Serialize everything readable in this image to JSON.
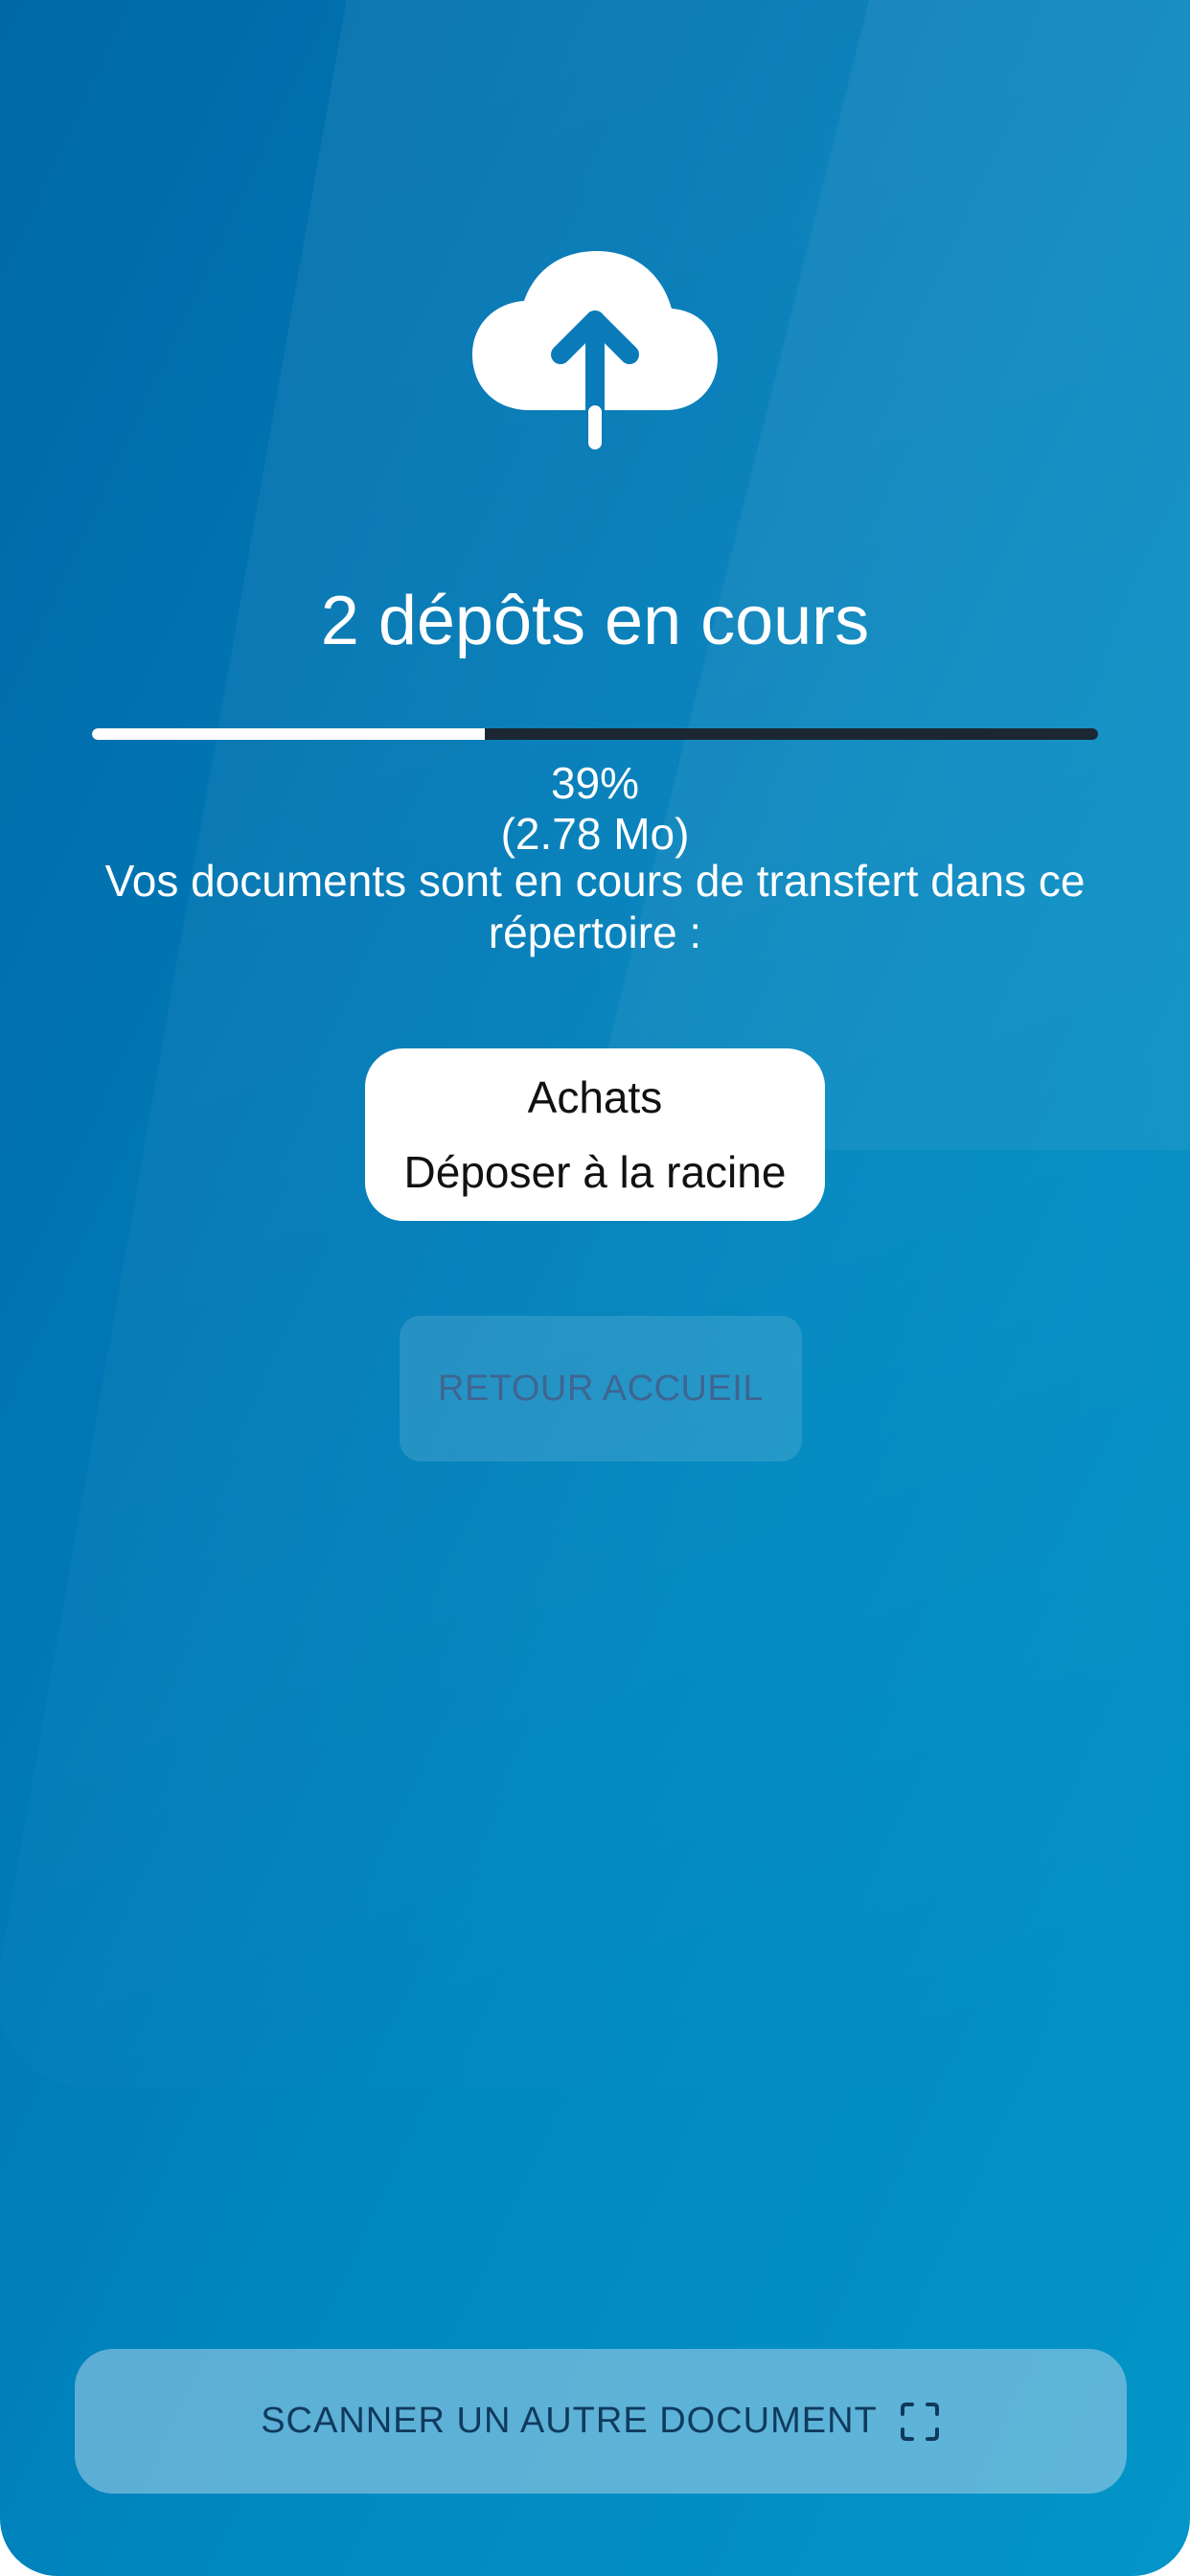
{
  "upload": {
    "title": "2 dépôts en cours",
    "progress_fraction": 0.39,
    "percent_label": "39%",
    "size_label": "(2.78 Mo)",
    "message": "Vos documents sont en cours de transfert dans ce répertoire :"
  },
  "folder": {
    "name": "Achats",
    "action": "Déposer à la racine"
  },
  "actions": {
    "home_label": "RETOUR ACCUEIL",
    "scan_label": "SCANNER UN AUTRE DOCUMENT"
  },
  "icons": {
    "upload": "cloud-upload-icon",
    "scan": "scan-frame-icon"
  },
  "colors": {
    "background_start": "#0068a6",
    "background_end": "#0395c8",
    "progress_fill": "#ffffff",
    "progress_track": "#1b2733",
    "home_button_text": "#3f6591",
    "scan_button_text": "#0f3a5e"
  }
}
